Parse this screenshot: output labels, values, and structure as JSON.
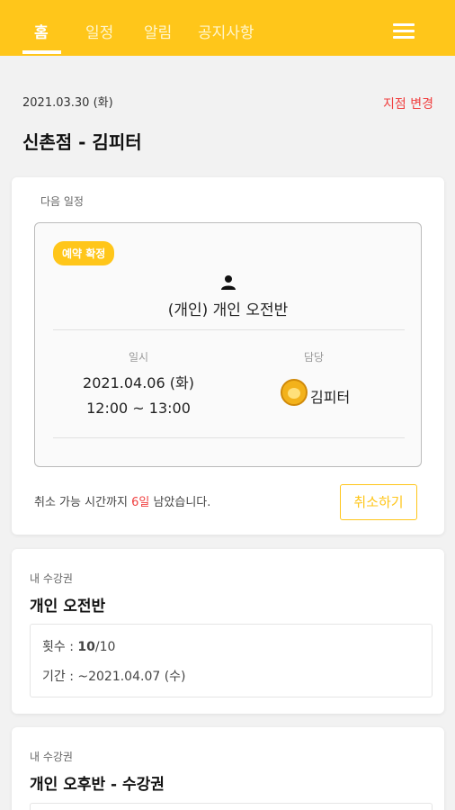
{
  "nav": {
    "tabs": [
      {
        "label": "홈"
      },
      {
        "label": "일정"
      },
      {
        "label": "알림"
      },
      {
        "label": "공지사항"
      }
    ],
    "menu_icon": "hamburger-icon"
  },
  "header": {
    "date": "2021.03.30 (화)",
    "branch_change": "지점 변경",
    "branch_title": "신촌점 - 김피터"
  },
  "next_schedule": {
    "label": "다음 일정",
    "badge": "예약 확정",
    "class_name": "(개인) 개인 오전반",
    "datetime_label": "일시",
    "date": "2021.04.06 (화)",
    "time": "12:00 ~ 13:00",
    "staff_label": "담당",
    "staff_name": "김피터",
    "cancel_note_prefix": "취소 가능 시간까지 ",
    "cancel_note_days": "6일",
    "cancel_note_suffix": " 남았습니다.",
    "cancel_button": "취소하기"
  },
  "tickets": [
    {
      "label": "내 수강권",
      "title": "개인 오전반",
      "count_prefix": "횟수 : ",
      "count_used": "10",
      "count_total": "/10",
      "period": "기간 : ~2021.04.07 (수)"
    },
    {
      "label": "내 수강권",
      "title": "개인 오후반 - 수강권"
    }
  ],
  "colors": {
    "accent": "#ffc61a",
    "alert": "#f04040"
  }
}
